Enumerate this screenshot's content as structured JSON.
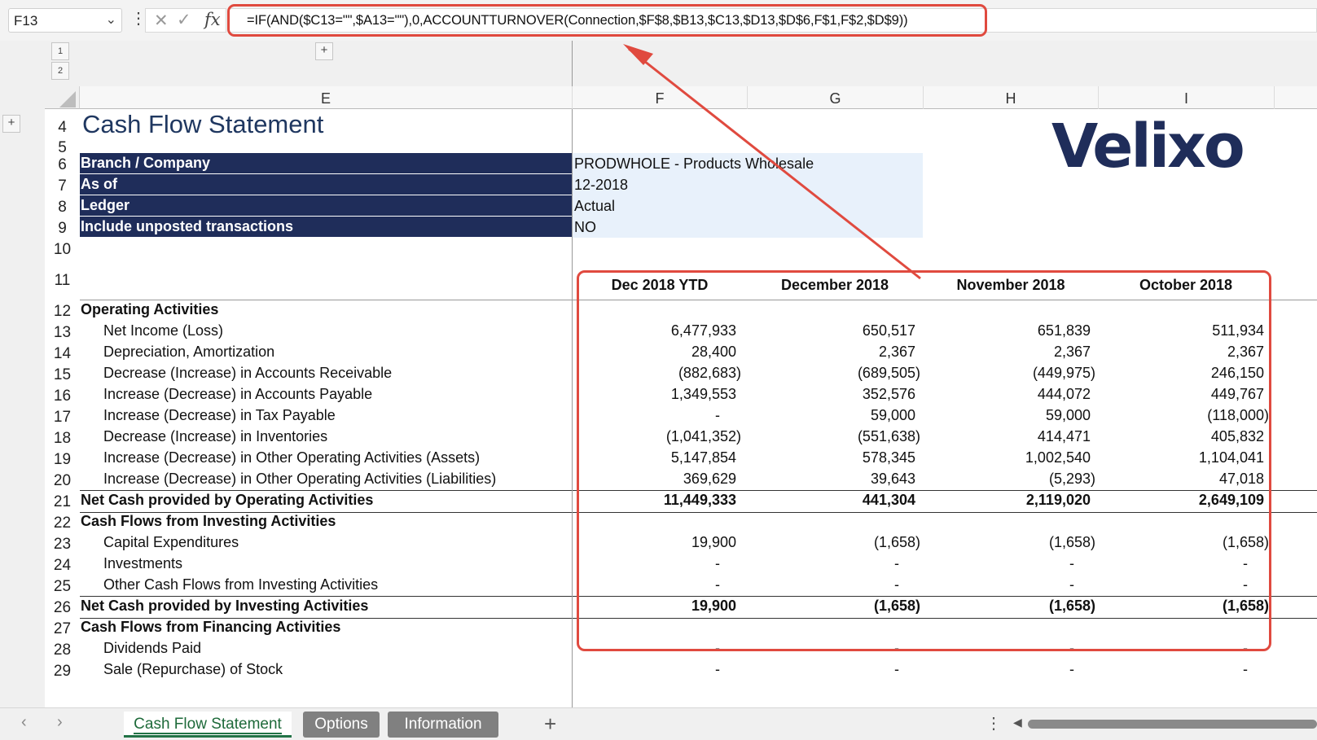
{
  "name_box": {
    "value": "F13"
  },
  "formula": "=IF(AND($C13=\"\",$A13=\"\"),0,ACCOUNTTURNOVER(Connection,$F$8,$B13,$C13,$D13,$D$6,F$1,F$2,$D$9))",
  "icons": {
    "cancel": "✕",
    "enter": "✓",
    "fx": "fx",
    "dots": "⋮",
    "dropdown": "⌄"
  },
  "outline": {
    "level1": "1",
    "level2": "2",
    "plus": "+"
  },
  "columns": [
    "E",
    "F",
    "G",
    "H",
    "I"
  ],
  "rows": [
    "4",
    "5",
    "6",
    "7",
    "8",
    "9",
    "10",
    "11",
    "12",
    "13",
    "14",
    "15",
    "16",
    "17",
    "18",
    "19",
    "20",
    "21",
    "22",
    "23",
    "24",
    "25",
    "26",
    "27",
    "28",
    "29"
  ],
  "sheet": {
    "title": "Cash Flow Statement",
    "logo": "Velixo",
    "parameters": [
      {
        "label": "Branch / Company",
        "value": "PRODWHOLE - Products Wholesale"
      },
      {
        "label": "As of",
        "value": "12-2018"
      },
      {
        "label": "Ledger",
        "value": "Actual"
      },
      {
        "label": "Include unposted transactions",
        "value": "NO"
      }
    ],
    "period_headers": [
      "Dec 2018 YTD",
      "December 2018",
      "November 2018",
      "October 2018"
    ],
    "lines": [
      {
        "label": "Operating Activities",
        "type": "section",
        "values": []
      },
      {
        "label": "Net Income (Loss)",
        "type": "item",
        "values": [
          "6,477,933",
          "650,517",
          "651,839",
          "511,934"
        ]
      },
      {
        "label": "Depreciation, Amortization",
        "type": "item",
        "values": [
          "28,400",
          "2,367",
          "2,367",
          "2,367"
        ]
      },
      {
        "label": "Decrease (Increase) in Accounts Receivable",
        "type": "item",
        "values": [
          "(882,683)",
          "(689,505)",
          "(449,975)",
          "246,150"
        ]
      },
      {
        "label": "Increase (Decrease) in Accounts Payable",
        "type": "item",
        "values": [
          "1,349,553",
          "352,576",
          "444,072",
          "449,767"
        ]
      },
      {
        "label": "Increase (Decrease) in Tax Payable",
        "type": "item",
        "values": [
          "-",
          "59,000",
          "59,000",
          "(118,000)"
        ]
      },
      {
        "label": "Decrease (Increase) in Inventories",
        "type": "item",
        "values": [
          "(1,041,352)",
          "(551,638)",
          "414,471",
          "405,832"
        ]
      },
      {
        "label": "Increase (Decrease) in Other Operating Activities (Assets)",
        "type": "item",
        "values": [
          "5,147,854",
          "578,345",
          "1,002,540",
          "1,104,041"
        ]
      },
      {
        "label": "Increase (Decrease) in Other Operating Activities (Liabilities)",
        "type": "item",
        "values": [
          "369,629",
          "39,643",
          "(5,293)",
          "47,018"
        ]
      },
      {
        "label": "Net Cash provided by Operating Activities",
        "type": "total",
        "values": [
          "11,449,333",
          "441,304",
          "2,119,020",
          "2,649,109"
        ]
      },
      {
        "label": "Cash Flows from Investing Activities",
        "type": "section",
        "values": []
      },
      {
        "label": "Capital Expenditures",
        "type": "item",
        "values": [
          "19,900",
          "(1,658)",
          "(1,658)",
          "(1,658)"
        ]
      },
      {
        "label": "Investments",
        "type": "item",
        "values": [
          "-",
          "-",
          "-",
          "-"
        ]
      },
      {
        "label": "Other Cash Flows from Investing Activities",
        "type": "item",
        "values": [
          "-",
          "-",
          "-",
          "-"
        ]
      },
      {
        "label": "Net Cash provided by Investing Activities",
        "type": "total",
        "values": [
          "19,900",
          "(1,658)",
          "(1,658)",
          "(1,658)"
        ]
      },
      {
        "label": "Cash Flows from Financing Activities",
        "type": "section",
        "values": []
      },
      {
        "label": "Dividends Paid",
        "type": "item",
        "values": [
          "-",
          "-",
          "-",
          "-"
        ]
      },
      {
        "label": "Sale (Repurchase) of Stock",
        "type": "item",
        "values": [
          "-",
          "-",
          "-",
          "-"
        ]
      }
    ]
  },
  "tabs": {
    "items": [
      "Cash Flow Statement",
      "Options",
      "Information"
    ],
    "active": "Cash Flow Statement",
    "add": "+",
    "prev": "‹",
    "next": "›",
    "more": "⋮",
    "scroll_left": "◀"
  },
  "colors": {
    "header_fill": "#1f2d5a",
    "info_fill": "#e8f1fb",
    "highlight": "#e04a3f",
    "title": "#1f3760"
  }
}
